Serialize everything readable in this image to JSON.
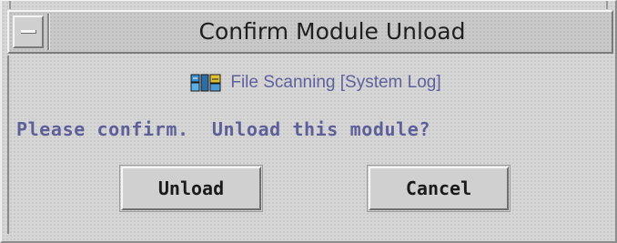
{
  "window": {
    "title": "Confirm Module Unload"
  },
  "module": {
    "icon": "module-icon",
    "label": "File Scanning [System Log]"
  },
  "prompt": {
    "text": "Please confirm.  Unload this module?"
  },
  "buttons": {
    "unload_label": "Unload",
    "cancel_label": "Cancel"
  },
  "colors": {
    "background": "#d6d6d6",
    "prompt_text": "#5e5e98",
    "module_text": "#5f5f9e"
  }
}
